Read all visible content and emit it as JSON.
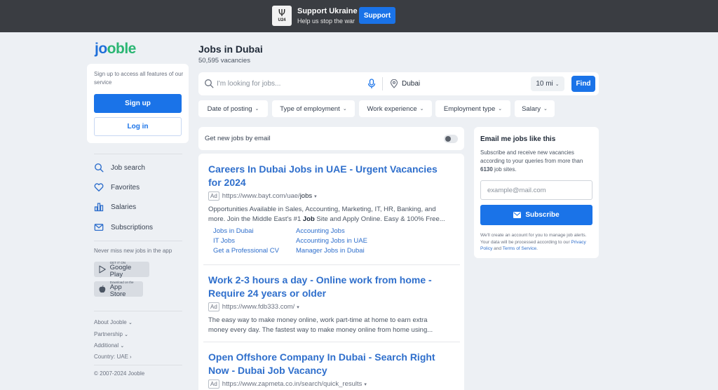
{
  "banner": {
    "badge_text": "U24",
    "title": "Support Ukraine",
    "subtitle": "Help us stop the war",
    "button": "Support"
  },
  "logo": {
    "part1": "jo",
    "part2": "oble"
  },
  "signup": {
    "text": "Sign up to access all features of our service",
    "signup_button": "Sign up",
    "login_button": "Log in"
  },
  "sidebar": {
    "items": [
      {
        "label": "Job search",
        "icon": "search-icon"
      },
      {
        "label": "Favorites",
        "icon": "heart-icon"
      },
      {
        "label": "Salaries",
        "icon": "salaries-icon"
      },
      {
        "label": "Subscriptions",
        "icon": "mail-icon"
      }
    ],
    "never_miss": "Never miss new jobs in the app",
    "google_play": {
      "small": "GET IT ON",
      "big": "Google Play"
    },
    "app_store": {
      "small": "Download on the",
      "big": "App Store"
    },
    "footer": {
      "about": "About Jooble",
      "partnership": "Partnership",
      "additional": "Additional",
      "country": "Country: UAE",
      "copyright": "© 2007-2024 Jooble"
    }
  },
  "header": {
    "title": "Jobs in Dubai",
    "vacancies": "50,595 vacancies"
  },
  "search": {
    "placeholder": "I'm looking for jobs...",
    "location": "Dubai",
    "distance": "10 mi",
    "find_button": "Find"
  },
  "filters": [
    "Date of posting",
    "Type of employment",
    "Work experience",
    "Employment type",
    "Salary"
  ],
  "email_toggle": {
    "label": "Get new jobs by email"
  },
  "results": [
    {
      "title_line1": "Careers In Dubai Jobs in UAE - Urgent Vacancies",
      "title_line2": "for 2024",
      "ad": "Ad",
      "url_prefix": "https://www.bayt.com/uae/",
      "url_bold": "jobs",
      "desc_line1": "Opportunities Available in Sales, Accounting, Marketing, IT, HR, Banking, and",
      "desc_pre": "more. Join the Middle East's #1 ",
      "desc_bold": "Job",
      "desc_post": " Site and Apply Online. Easy & 100% Free...",
      "links": [
        "Jobs in Dubai",
        "Accounting Jobs",
        "IT Jobs",
        "Accounting Jobs in UAE",
        "Get a Professional CV",
        "Manager Jobs in Dubai"
      ]
    },
    {
      "title_line1": "Work 2-3 hours a day - Online work from home -",
      "title_line2": "Require 24 years or older",
      "ad": "Ad",
      "url": "https://www.fdb333.com/",
      "desc_line1": "The easy way to make money online, work part-time at home to earn extra",
      "desc_line2": "money every day. The fastest way to make money online from home using..."
    },
    {
      "title_line1": "Open Offshore Company In Dubai - Search Right",
      "title_line2": "Now - Dubai Job Vacancy",
      "ad": "Ad",
      "url": "https://www.zapmeta.co.in/search/quick_results"
    }
  ],
  "email_card": {
    "title": "Email me jobs like this",
    "desc_pre": "Subscribe and receive new vacancies according to your queries from more than ",
    "desc_bold": "6130",
    "desc_post": " job sites.",
    "placeholder": "example@mail.com",
    "button": "Subscribe",
    "note_pre": "We'll create an account for you to manage job alerts. Your data will be processed according to our ",
    "privacy": "Privacy Policy",
    "and": " and ",
    "terms": "Terms of Service",
    "period": "."
  },
  "colors": {
    "accent": "#1a73e8",
    "link": "#2f6fcc",
    "banner_bg": "#3a3d42",
    "page_bg": "#edf0f4"
  }
}
